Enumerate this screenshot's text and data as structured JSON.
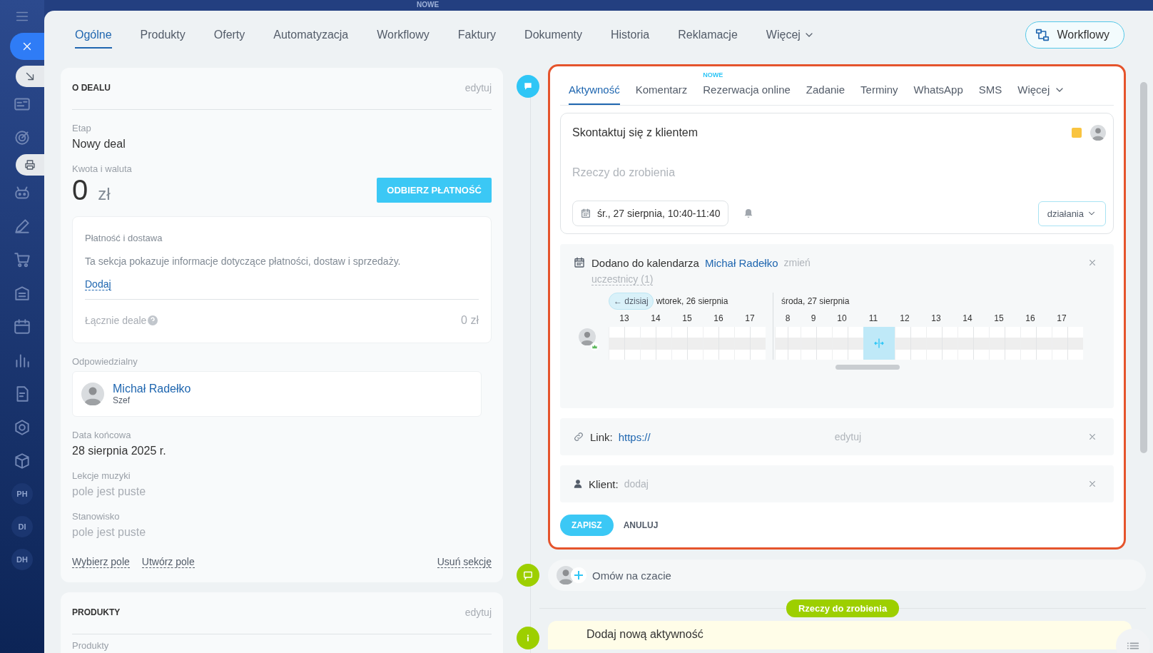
{
  "top_badge": "NOWE",
  "sidebar": {
    "avatars": [
      "PH",
      "DI",
      "DH"
    ]
  },
  "tabs": [
    {
      "label": "Ogólne",
      "selected": true
    },
    {
      "label": "Produkty",
      "selected": false
    },
    {
      "label": "Oferty",
      "selected": false
    },
    {
      "label": "Automatyzacja",
      "selected": false
    },
    {
      "label": "Workflowy",
      "selected": false
    },
    {
      "label": "Faktury",
      "selected": false
    },
    {
      "label": "Dokumenty",
      "selected": false
    },
    {
      "label": "Historia",
      "selected": false
    },
    {
      "label": "Reklamacje",
      "selected": false
    },
    {
      "label": "Więcej",
      "selected": false
    }
  ],
  "workflow_button": "Workflowy",
  "deal_section": {
    "title": "O DEALU",
    "edit": "edytuj",
    "stage": {
      "label": "Etap",
      "value": "Nowy deal"
    },
    "amount": {
      "label": "Kwota i waluta",
      "value": "0",
      "currency": "zł"
    },
    "pay_button": "ODBIERZ PŁATNOŚĆ",
    "payment": {
      "title": "Płatność i dostawa",
      "text": "Ta sekcja pokazuje informacje dotyczące płatności, dostaw i sprzedaży.",
      "add_link": "Dodaj",
      "total_label": "Łącznie deale",
      "total_value": "0 zł"
    },
    "responsible": {
      "label": "Odpowiedzialny",
      "name": "Michał Radełko",
      "role": "Szef"
    },
    "fields": [
      {
        "label": "Data końcowa",
        "value": "28 sierpnia 2025 r.",
        "empty": false
      },
      {
        "label": "Lekcje muzyki",
        "value": "pole jest puste",
        "empty": true
      },
      {
        "label": "Stanowisko",
        "value": "pole jest puste",
        "empty": true
      }
    ],
    "links": [
      "Wybierz pole",
      "Utwórz pole"
    ],
    "remove_link": "Usuń sekcję"
  },
  "products_section": {
    "title": "PRODUKTY",
    "edit": "edytuj",
    "field_label": "Produkty"
  },
  "editor": {
    "tabs": [
      {
        "label": "Aktywność",
        "selected": true
      },
      {
        "label": "Komentarz",
        "selected": false
      },
      {
        "label": "Rezerwacja online",
        "selected": false,
        "badge": "NOWE"
      },
      {
        "label": "Zadanie",
        "selected": false
      },
      {
        "label": "Terminy",
        "selected": false
      },
      {
        "label": "WhatsApp",
        "selected": false
      },
      {
        "label": "SMS",
        "selected": false
      },
      {
        "label": "Więcej",
        "selected": false
      }
    ],
    "task": {
      "title": "Skontaktuj się z klientem",
      "color": "#f9c440",
      "placeholder": "Rzeczy do zrobienia",
      "date": "śr., 27 sierpnia, 10:40-11:40",
      "actions": "działania"
    },
    "calendar": {
      "title": "Dodano do kalendarza",
      "owner": "Michał Radełko",
      "change": "zmień",
      "participants": "uczestnicy (1)",
      "today_button": "← dzisiaj",
      "days": [
        {
          "label": "wtorek, 26 sierpnia",
          "hours": [
            {
              "label": "13",
              "selected": false
            },
            {
              "label": "14",
              "selected": false
            },
            {
              "label": "15",
              "selected": false
            },
            {
              "label": "16",
              "selected": false
            },
            {
              "label": "17",
              "selected": false
            }
          ]
        },
        {
          "label": "środa, 27 sierpnia",
          "hours": [
            {
              "label": "8",
              "selected": false
            },
            {
              "label": "9",
              "selected": false
            },
            {
              "label": "10",
              "selected": false
            },
            {
              "label": "11",
              "selected": true
            },
            {
              "label": "12",
              "selected": false
            },
            {
              "label": "13",
              "selected": false
            },
            {
              "label": "14",
              "selected": false
            },
            {
              "label": "15",
              "selected": false
            },
            {
              "label": "16",
              "selected": false
            },
            {
              "label": "17",
              "selected": false
            }
          ]
        }
      ]
    },
    "link": {
      "label": "Link:",
      "value": "https://",
      "edit": "edytuj"
    },
    "client": {
      "label": "Klient:",
      "action": "dodaj"
    },
    "save": "ZAPISZ",
    "cancel": "ANULUJ"
  },
  "feed": {
    "chat": "Omów na czacie",
    "divider": "Rzeczy do zrobienia",
    "next_item": "Dodaj nową aktywność"
  }
}
